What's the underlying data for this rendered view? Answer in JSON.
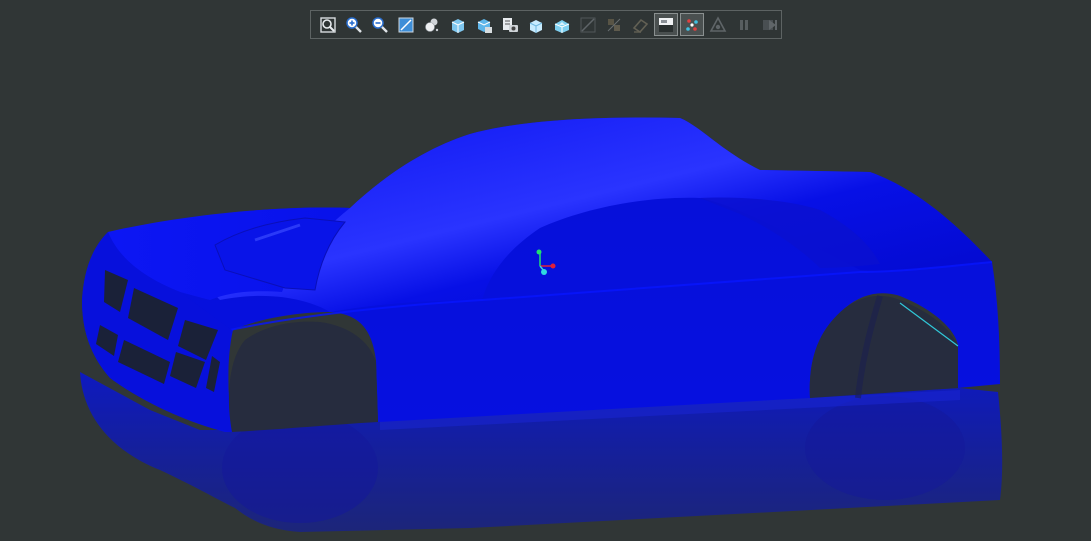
{
  "app": {
    "background_color": "#303636"
  },
  "model": {
    "body_color": "#0a12e6",
    "reflection_color": "#0f1fa8"
  },
  "axis_gizmo": {
    "x_color": "#e0203a",
    "y_color": "#20e070",
    "z_color": "#30d8e0"
  },
  "toolbar": {
    "buttons": [
      {
        "icon": "zoom-fit-icon",
        "state": "enabled"
      },
      {
        "icon": "zoom-in-icon",
        "state": "enabled"
      },
      {
        "icon": "zoom-out-icon",
        "state": "enabled"
      },
      {
        "icon": "zoom-window-icon",
        "state": "enabled"
      },
      {
        "icon": "shading-mode-icon",
        "state": "enabled"
      },
      {
        "icon": "view-orientation-icon",
        "state": "enabled"
      },
      {
        "icon": "standard-views-icon",
        "state": "enabled"
      },
      {
        "icon": "snapshot-icon",
        "state": "enabled"
      },
      {
        "icon": "section-view-icon",
        "state": "enabled"
      },
      {
        "icon": "explode-view-icon",
        "state": "enabled"
      },
      {
        "icon": "measure-icon",
        "state": "disabled"
      },
      {
        "icon": "move-parts-icon",
        "state": "disabled"
      },
      {
        "icon": "eraser-icon",
        "state": "disabled"
      },
      {
        "icon": "display-panel-icon",
        "state": "active"
      },
      {
        "icon": "points-icon",
        "state": "active"
      },
      {
        "icon": "material-icon",
        "state": "disabled"
      },
      {
        "icon": "pause-icon",
        "state": "disabled"
      },
      {
        "icon": "step-forward-icon",
        "state": "disabled"
      }
    ]
  }
}
